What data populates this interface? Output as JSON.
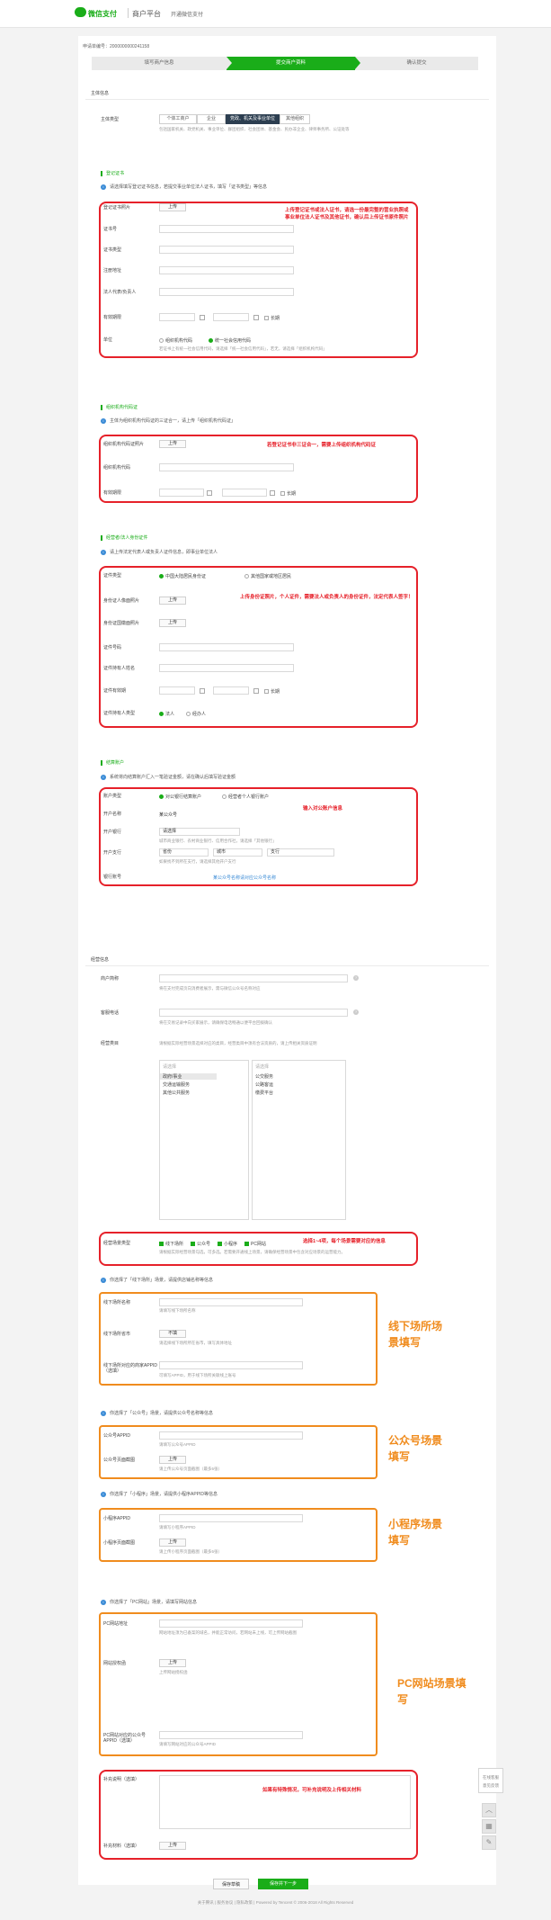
{
  "header": {
    "brand": "微信支付",
    "title": "商户平台",
    "link": "开通微信支付"
  },
  "apply_no": "申请单编号：2000000000241158",
  "steps": [
    "填写商户信息",
    "提交商户资料",
    "确认提交"
  ],
  "groups": {
    "entity": "主体信息",
    "business": "经营信息"
  },
  "subject_type": {
    "label": "主体类型",
    "options": [
      "个体工商户",
      "企业",
      "党政、机关及事业单位",
      "其他组织"
    ],
    "hint": "包括国家机关、政党机关、事业单位、群团组织、社会团体、基金会、民办非企业、律师事务所、公证处等"
  },
  "cert": {
    "title": "登记证书",
    "tip": "请选择填写登记证书信息，若提交事业单位法人证书，填写「证书类型」等信息",
    "upload_label": "登记证书照片",
    "fields": [
      "证书号",
      "证书类型",
      "注册地址",
      "法人代表/负责人"
    ],
    "validity_label": "有效期限",
    "long_term": "长期",
    "unit_label": "单位",
    "unit_options": [
      "组织机构代码",
      "统一社会信用代码"
    ],
    "unit_hint": "若证书上有统一社会信用代码，请选择「统一社会信用代码」，若无，请选择「组织机构代码」",
    "note": "上传登记证书或法人证书，请选一份最完整的营业执照或事业单位法人证书及其他证书，确认后上传证书原件照片"
  },
  "org": {
    "title": "组织机构代码证",
    "tip": "主体为组织机构代码证的三证合一，请上传「组织机构代码证」",
    "fields": [
      "组织机构代码证照片",
      "组织机构代码",
      "有效期限"
    ],
    "note": "若登记证书非三证合一，需要上传组织机构代码证"
  },
  "id": {
    "title": "经营者/法人身份证件",
    "tip": "请上传法定代表人或负责人证件信息，即事业单位法人",
    "type_label": "证件类型",
    "type_options": [
      "中国大陆居民身份证",
      "其他国家或地区居民"
    ],
    "fields": [
      "身份证人像面照片",
      "身份证国徽面照片",
      "证件号码",
      "证件持有人姓名",
      "证件有效期",
      "证件持有人类型"
    ],
    "long_term": "长期",
    "holder_options": [
      "法人",
      "经办人"
    ],
    "note": "上传身份证照片，个人证件，需要法人或负责人的身份证件，法定代表人签字！"
  },
  "settle": {
    "title": "结算账户",
    "tip": "系统将向结算账户汇入一笔验证金额，请在确认后填写验证金额",
    "options": [
      "对公银行结算账户",
      "经营者个人银行账户"
    ],
    "fields": [
      "账户类型",
      "开户名称",
      "开户银行",
      "开户支行",
      "银行账号"
    ],
    "name_val": "某公众号",
    "bank_val": "请选择",
    "bank_hint": "城市商业银行、农村商业银行、信用合作社，请选择「其他银行」",
    "region": [
      "省份",
      "城市",
      "支行"
    ],
    "branch_hint": "如果找不到所在支行，请选择其他开户支行",
    "account_link": "某公众号名称请对应公众号名称",
    "note": "输入对公账户信息"
  },
  "biz": {
    "short_label": "商户简称",
    "short_hint": "将在支付完成页向消费者展示，需与微信公众号名称对应",
    "phone_label": "客服电话",
    "phone_hint": "将在交易记录中向买家展示，请确保电话畅通以便平台回拨确认",
    "category_label": "经营类目",
    "category_hint": "请根据实际经营场景选择对应的类目，经营类目中须有合法资质的，请上传相关资质证明",
    "search_ph": "请选择",
    "left_items": [
      "政府/事业",
      "交通运输服务",
      "其他公共服务"
    ],
    "right_items": [
      "公交服务",
      "公路客运",
      "缴费平台"
    ],
    "scene_label": "经营场景类型",
    "scenes": [
      "线下场所",
      "公众号",
      "小程序",
      "PC网站"
    ],
    "scene_hint": "请根据实际经营场景勾选，可多选。若需要开通线上场景，请确保经营场景中包含对应场景的运营能力。",
    "scene_note": "选择1~4项，每个场景需要对应的信息"
  },
  "offline": {
    "tip": "你选择了「线下场所」场景，请提供店铺名称等信息",
    "fields": [
      "线下场所名称",
      "线下场所省市",
      "线下场所对应的商家APPID（选填）"
    ],
    "hints": [
      "请填写线下场所名称",
      "请选择线下场所所在省市，填写具体地址",
      "可填写APPID，用于线下场所关联线上账号"
    ],
    "btn": "不填",
    "note": "线下场所场景填写"
  },
  "mp": {
    "tip": "你选择了「公众号」场景，请提供公众号名称等信息",
    "fields": [
      "公众号APPID",
      "公众号页面截图"
    ],
    "hints": [
      "请填写公众号APPID",
      "请上传公众号页面截图（最多5张）"
    ],
    "upload": "上传",
    "note": "公众号场景填写"
  },
  "mini": {
    "tip": "你选择了「小程序」场景，请提供小程序APPID等信息",
    "fields": [
      "小程序APPID",
      "小程序页面截图"
    ],
    "hints": [
      "请填写小程序APPID",
      "请上传小程序页面截图（最多5张）"
    ],
    "upload": "上传",
    "note": "小程序场景填写"
  },
  "pc": {
    "tip": "你选择了「PC网站」场景，请填写网站信息",
    "fields": [
      "PC网站地址",
      "网站授权函",
      "PC网站对应的公众号APPID（选填）"
    ],
    "hints": [
      "网站地址须为已备案的域名，并能正常访问，若网站未上线，可上传网站截图",
      "上传网站授权函",
      "请填写网站对应的公众号APPID"
    ],
    "upload": "上传",
    "note": "PC网站场景填写"
  },
  "extra": {
    "fields": [
      "补充说明（选填）",
      "补充材料（选填）"
    ],
    "upload": "上传",
    "note": "如果有特殊情况，可补充说明及上传相关材料"
  },
  "buttons": {
    "save": "保存草稿",
    "next": "保存并下一步"
  },
  "footer": "关于腾讯 | 服务协议 | 隐私政策 | Powered by Tencent © 2006-2018 All Rights Reserved",
  "side": {
    "help": "在线客服",
    "feedback": "意见反馈"
  }
}
